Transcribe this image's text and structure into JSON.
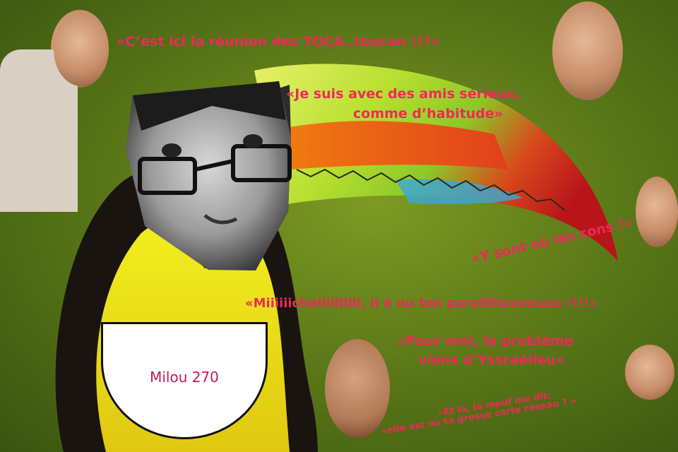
{
  "captions": {
    "toca": "«C’est ici la réunion des TOCA..toucan !!?»",
    "amis_line1": "«Je suis avec des amis sérieux,",
    "amis_line2": "comme d’habitude»",
    "cons": "«Y sont où les cons !»",
    "michel": "«Miiiiiichellllllllll, il é ou ton paralllllaxxeuuu !!!!»",
    "probleme_line1": "«Pour moi, le problème",
    "probleme_line2": "viens d’Yssraélleu»",
    "meuf_line1": "«Et là, la meuf me dit:",
    "meuf_line2": "«elle est où ta grosse carte réseau ? »"
  },
  "label": "Milou 270",
  "colors": {
    "caption": "#ec2a57",
    "label_text": "#c2185b",
    "background": "#5c7a18"
  }
}
